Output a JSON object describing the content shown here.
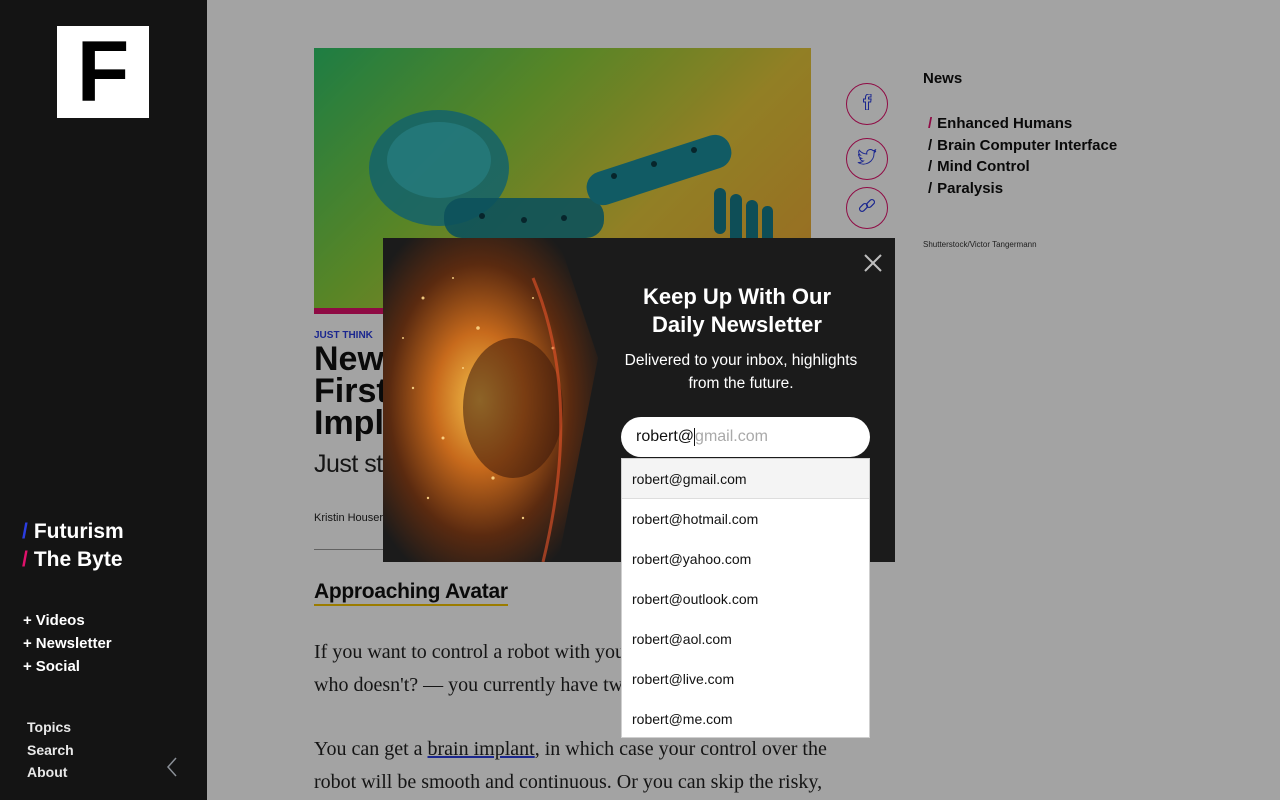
{
  "sidebar": {
    "logo": "F",
    "brands": [
      {
        "slash": "/",
        "label": "Futurism",
        "slash_color": "#2b3de0"
      },
      {
        "slash": "/",
        "label": "The Byte",
        "slash_color": "#e0116b"
      }
    ],
    "sections": [
      {
        "prefix": "+",
        "label": "Videos"
      },
      {
        "prefix": "+",
        "label": "Newsletter"
      },
      {
        "prefix": "+",
        "label": "Social"
      }
    ],
    "links": [
      "Topics",
      "Search",
      "About"
    ],
    "collapse_icon": "chevron-left-icon"
  },
  "article": {
    "kicker": "JUST THINK",
    "headline_lines": [
      "New",
      "First",
      "Impla"
    ],
    "dek": "Just str",
    "byline": "Kristin Houser",
    "subhead": "Approaching Avatar",
    "para1_lines": [
      "If you want to control a robot with your",
      "who doesn't? — you currently have two"
    ],
    "para2_prefix": "You can get a ",
    "para2_link": "brain implant",
    "para2_suffix": ", in which case your control over the",
    "para2_line2": "robot will be smooth and continuous. Or you can skip the risky,"
  },
  "share": [
    {
      "icon": "facebook-icon"
    },
    {
      "icon": "twitter-icon"
    },
    {
      "icon": "link-icon"
    }
  ],
  "tags": {
    "title": "News",
    "items": [
      {
        "slash": "/",
        "label": "Enhanced Humans",
        "slash_color": "#e0116b"
      },
      {
        "slash": "/",
        "label": "Brain Computer Interface",
        "slash_color": "#111"
      },
      {
        "slash": "/",
        "label": "Mind Control",
        "slash_color": "#111"
      },
      {
        "slash": "/",
        "label": "Paralysis",
        "slash_color": "#111"
      }
    ],
    "credit": "Shutterstock/Victor Tangermann"
  },
  "modal": {
    "title_lines": [
      "Keep Up With Our",
      "Daily Newsletter"
    ],
    "subtitle_lines": [
      "Delivered to your inbox, highlights",
      "from the future."
    ],
    "email_typed": "robert@",
    "email_suggestion": "gmail.com",
    "close_icon": "close-icon"
  },
  "autocomplete": {
    "options": [
      "robert@gmail.com",
      "robert@hotmail.com",
      "robert@yahoo.com",
      "robert@outlook.com",
      "robert@aol.com",
      "robert@live.com",
      "robert@me.com"
    ],
    "active_index": 0
  },
  "colors": {
    "accent_blue": "#2b3de0",
    "accent_pink": "#e0116b",
    "accent_yellow": "#f3c200"
  }
}
